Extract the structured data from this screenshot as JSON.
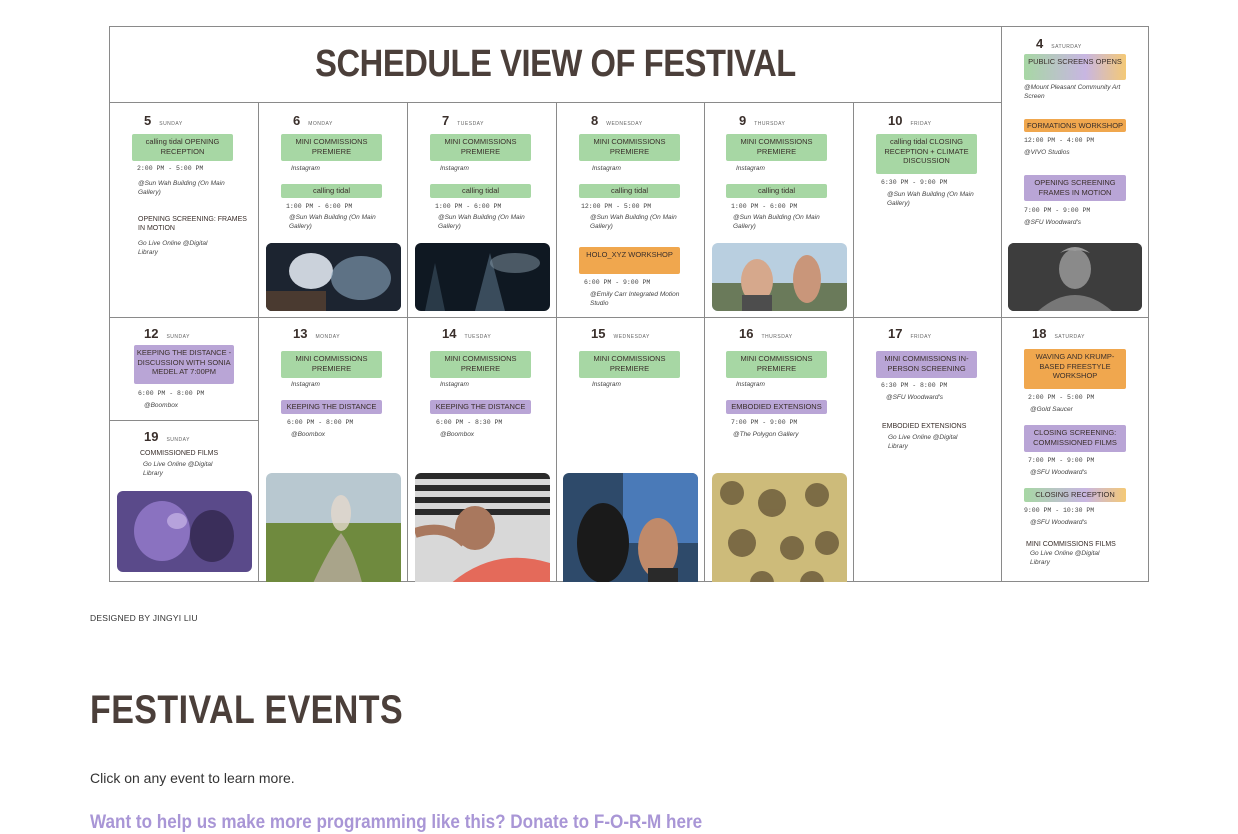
{
  "schedule": {
    "title": "SCHEDULE VIEW OF FESTIVAL",
    "days": {
      "d4": {
        "num": "4",
        "name": "SATURDAY",
        "e1": "PUBLIC SCREENS OPENS",
        "e1_loc": "@Mount Pleasant Community Art Screen",
        "e2": "FORMations WORKSHOP",
        "e2_time": "12:00 PM - 4:00 PM",
        "e2_loc": "@VIVO Studios",
        "e3": "OPENING SCREENING FRAMES IN MOTION",
        "e3_time": "7:00 PM - 9:00 PM",
        "e3_loc": "@SFU Woodward's"
      },
      "d5": {
        "num": "5",
        "name": "SUNDAY",
        "e1": "calling tidal OPENING RECEPTION",
        "e1_time": "2:00 PM - 5:00 PM",
        "e1_loc": "@Sun Wah Building (On Main Gallery)",
        "e2": "OPENING SCREENING: FRAMES IN MOTION",
        "e2_loc": "Go Live Online @Digital Library"
      },
      "d6": {
        "num": "6",
        "name": "MONDAY",
        "e1": "MINI COMMISSIONS PREMIERE",
        "e1_loc": "Instagram",
        "e2": "calling tidal",
        "e2_time": "1:00 PM - 6:00 PM",
        "e2_loc": "@Sun Wah Building (On Main Gallery)"
      },
      "d7": {
        "num": "7",
        "name": "TUESDAY",
        "e1": "MINI COMMISSIONS PREMIERE",
        "e1_loc": "Instagram",
        "e2": "calling tidal",
        "e2_time": "1:00 PM - 6:00 PM",
        "e2_loc": "@Sun Wah Building (On Main Gallery)"
      },
      "d8": {
        "num": "8",
        "name": "WEDNESDAY",
        "e1": "MINI COMMISSIONS PREMIERE",
        "e1_loc": "Instagram",
        "e2": "calling tidal",
        "e2_time": "12:00 PM - 5:00 PM",
        "e2_loc": "@Sun Wah Building (On Main Gallery)",
        "e3": "HOLO_XYZ WORKSHOP",
        "e3_time": "6:00 PM - 9:00 PM",
        "e3_loc": "@Emily Carr Integrated Motion Studio"
      },
      "d9": {
        "num": "9",
        "name": "THURSDAY",
        "e1": "MINI COMMISSIONS PREMIERE",
        "e1_loc": "Instagram",
        "e2": "calling tidal",
        "e2_time": "1:00 PM - 6:00 PM",
        "e2_loc": "@Sun Wah Building (On Main Gallery)"
      },
      "d10": {
        "num": "10",
        "name": "FRIDAY",
        "e1": "calling tidal CLOSING RECEPTION + CLIMATE DISCUSSION",
        "e1_time": "6:30 PM - 9:00 PM",
        "e1_loc": "@Sun Wah Building (On Main Gallery)"
      },
      "d12": {
        "num": "12",
        "name": "SUNDAY",
        "e1": "KEEPING THE DISTANCE - DISCUSSION WITH SONIA MEDEL AT 7:00PM",
        "e1_time": "6:00 PM - 8:00 PM",
        "e1_loc": "@Boombox"
      },
      "d13": {
        "num": "13",
        "name": "MONDAY",
        "e1": "MINI COMMISSIONS PREMIERE",
        "e1_loc": "Instagram",
        "e2": "KEEPING THE DISTANCE",
        "e2_time": "6:00 PM - 8:00 PM",
        "e2_loc": "@Boombox"
      },
      "d14": {
        "num": "14",
        "name": "TUESDAY",
        "e1": "MINI COMMISSIONS PREMIERE",
        "e1_loc": "Instagram",
        "e2": "KEEPING THE DISTANCE",
        "e2_time": "6:00 PM - 8:30 PM",
        "e2_loc": "@Boombox"
      },
      "d15": {
        "num": "15",
        "name": "WEDNESDAY",
        "e1": "MINI COMMISSIONS PREMIERE",
        "e1_loc": "Instagram"
      },
      "d16": {
        "num": "16",
        "name": "THURSDAY",
        "e1": "MINI COMMISSIONS PREMIERE",
        "e1_loc": "Instagram",
        "e2": "EMBODIED EXTENSIONS",
        "e2_time": "7:00 PM - 9:00 PM",
        "e2_loc": "@The Polygon Gallery"
      },
      "d17": {
        "num": "17",
        "name": "FRIDAY",
        "e1": "MINI COMMISSIONS IN-PERSON SCREENING",
        "e1_time": "6:30 PM - 8:00 PM",
        "e1_loc": "@SFU Woodward's",
        "e2": "EMBODIED EXTENSIONS",
        "e2_loc": "Go Live Online @Digital Library"
      },
      "d18": {
        "num": "18",
        "name": "SATURDAY",
        "e1": "WAVING AND KRUMP-BASED FREESTYLE WORKSHOP",
        "e1_time": "2:00 PM - 5:00 PM",
        "e1_loc": "@Gold Saucer",
        "e2": "CLOSING SCREENING: COMMISSIONED FILMS",
        "e2_time": "7:00 PM - 9:00 PM",
        "e2_loc": "@SFU Woodward's",
        "e3": "CLOSING RECEPTION",
        "e3_time": "9:00 PM - 10:30 PM",
        "e3_loc": "@SFU Woodward's",
        "e4": "MINI COMMISSIONS FILMS",
        "e4_loc": "Go Live Online @Digital Library"
      },
      "d19": {
        "num": "19",
        "name": "SUNDAY",
        "e1": "COMMISSIONED FILMS",
        "e1_loc": "Go Live Online @Digital Library"
      }
    }
  },
  "credit": "DESIGNED BY JINGYI LIU",
  "section": {
    "title": "FESTIVAL EVENTS",
    "intro": "Click on any event to learn more.",
    "donate": "Want to help us make more programming like this? Donate to F-O-R-M here"
  },
  "colors": {
    "green": "#a7d7a4",
    "purple": "#b9a5d6",
    "orange": "#f0a74e",
    "link": "#a996d6"
  }
}
